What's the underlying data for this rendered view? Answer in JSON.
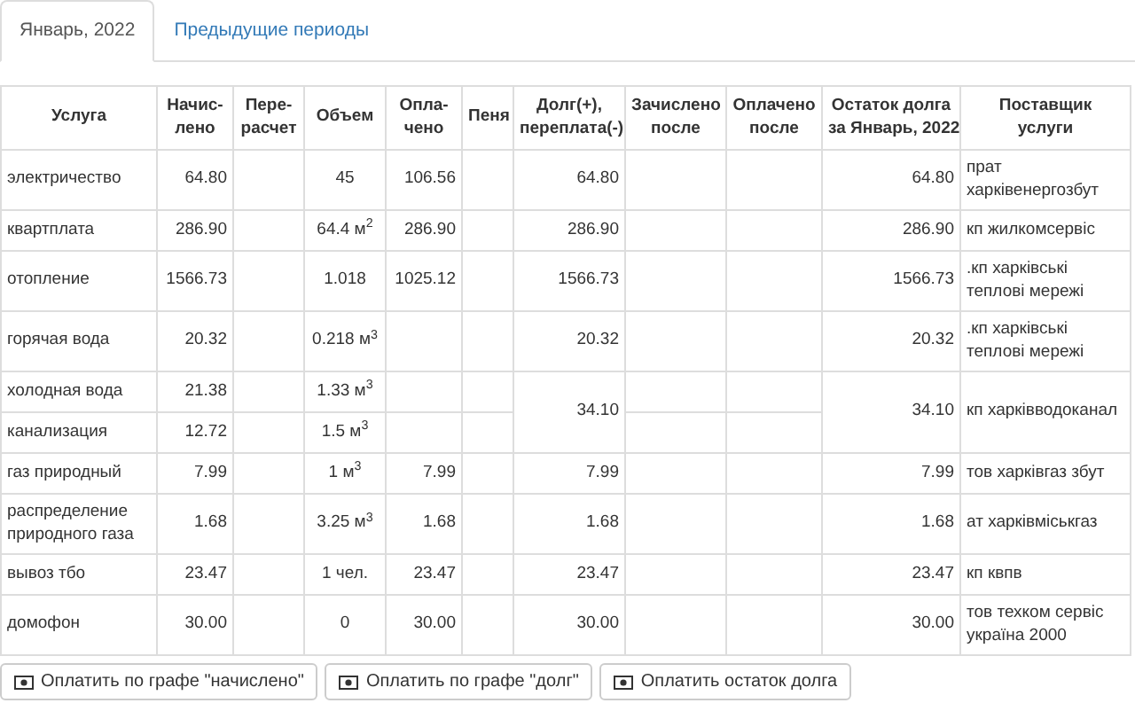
{
  "tabs": [
    {
      "label": "Январь, 2022",
      "selected": true
    },
    {
      "label": "Предыдущие периоды",
      "selected": false
    }
  ],
  "table": {
    "columns": [
      "Услуга",
      "Начис-\nлено",
      "Пере-\nрасчет",
      "Объем",
      "Опла-\nчено",
      "Пеня",
      "Долг(+),\nпереплата(-)",
      "Зачислено\nпосле",
      "Оплачено\nпосле",
      "Остаток долга\nза Январь, 2022",
      "Поставщик\nуслуги"
    ],
    "groups": [
      {
        "services": [
          {
            "name": "электричество",
            "accrued": "64.80",
            "volume": "45",
            "paid": "106.56"
          }
        ],
        "debt": "64.80",
        "remaining": "64.80",
        "supplier": "прат харківенергозбут"
      },
      {
        "services": [
          {
            "name": "квартплата",
            "accrued": "286.90",
            "volume": "64.4 м$^{2}$",
            "paid": "286.90"
          }
        ],
        "debt": "286.90",
        "remaining": "286.90",
        "supplier": "кп жилкомсервіс"
      },
      {
        "services": [
          {
            "name": "отопление",
            "accrued": "1566.73",
            "volume": "1.018",
            "paid": "1025.12"
          }
        ],
        "debt": "1566.73",
        "remaining": "1566.73",
        "supplier": ".кп харківські теплові мережі"
      },
      {
        "services": [
          {
            "name": "горячая вода",
            "accrued": "20.32",
            "volume": "0.218 м$^{3}$"
          }
        ],
        "debt": "20.32",
        "remaining": "20.32",
        "supplier": ".кп харківські теплові мережі"
      },
      {
        "services": [
          {
            "name": "холодная вода",
            "accrued": "21.38",
            "volume": "1.33 м$^{3}$"
          },
          {
            "name": "канализация",
            "accrued": "12.72",
            "volume": "1.5 м$^{3}$"
          }
        ],
        "debt": "34.10",
        "remaining": "34.10",
        "supplier": "кп харківводоканал"
      },
      {
        "services": [
          {
            "name": "газ природный",
            "accrued": "7.99",
            "volume": "1 м$^{3}$",
            "paid": "7.99"
          }
        ],
        "debt": "7.99",
        "remaining": "7.99",
        "supplier": "тов харківгаз збут"
      },
      {
        "services": [
          {
            "name": "распределение природного газа",
            "accrued": "1.68",
            "volume": "3.25 м$^{3}$",
            "paid": "1.68"
          }
        ],
        "debt": "1.68",
        "remaining": "1.68",
        "supplier": "ат харківміськгаз"
      },
      {
        "services": [
          {
            "name": "вывоз тбо",
            "accrued": "23.47",
            "volume": "1 чел.",
            "paid": "23.47"
          }
        ],
        "debt": "23.47",
        "remaining": "23.47",
        "supplier": "кп квпв"
      },
      {
        "services": [
          {
            "name": "домофон",
            "accrued": "30.00",
            "volume": "0",
            "paid": "30.00"
          }
        ],
        "debt": "30.00",
        "remaining": "30.00",
        "supplier": "тов техком сервіс україна 2000"
      }
    ]
  },
  "buttons": [
    "Оплатить по графе \"начислено\"",
    "Оплатить по графе \"долг\"",
    "Оплатить остаток долга"
  ]
}
